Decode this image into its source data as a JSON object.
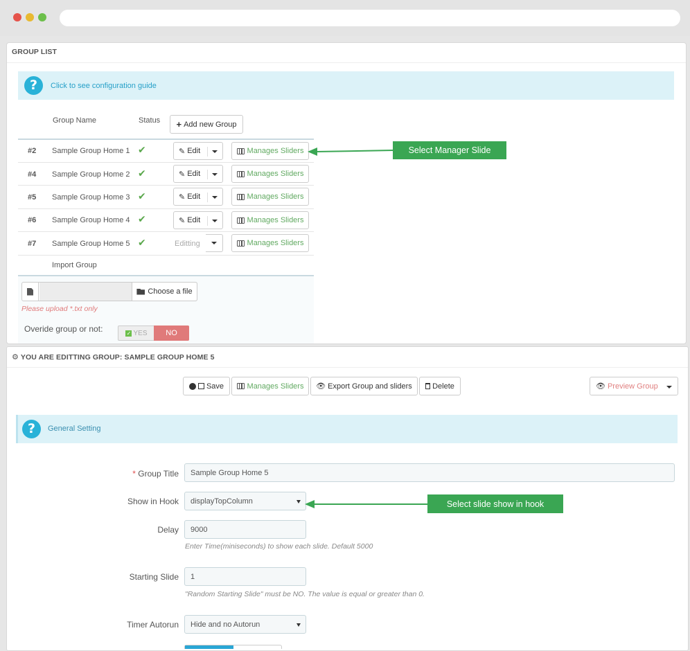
{
  "group_list": {
    "title": "GROUP LIST",
    "guide_link": "Click to see configuration guide",
    "headers": {
      "name": "Group Name",
      "status": "Status"
    },
    "add_button": "Add new Group",
    "rows": [
      {
        "id": "#2",
        "name": "Sample Group Home 1",
        "edit": "Edit",
        "manage": "Manages Sliders"
      },
      {
        "id": "#4",
        "name": "Sample Group Home 2",
        "edit": "Edit",
        "manage": "Manages Sliders"
      },
      {
        "id": "#5",
        "name": "Sample Group Home 3",
        "edit": "Edit",
        "manage": "Manages Sliders"
      },
      {
        "id": "#6",
        "name": "Sample Group Home 4",
        "edit": "Edit",
        "manage": "Manages Sliders"
      },
      {
        "id": "#7",
        "name": "Sample Group Home 5",
        "edit": "Editting",
        "manage": "Manages Sliders"
      }
    ],
    "import_label": "Import Group",
    "choose_file": "Choose a file",
    "upload_hint": "Please upload *.txt only",
    "override_label": "Overide group or not:",
    "yes": "YES",
    "no": "NO"
  },
  "annotations": {
    "manager_slide": "Select Manager Slide",
    "hook_slide": "Select slide show in hook"
  },
  "edit_panel": {
    "title": "YOU ARE EDITTING GROUP: SAMPLE GROUP HOME 5",
    "toolbar": {
      "save": "Save",
      "manage": "Manages Sliders",
      "export": "Export Group and sliders",
      "delete": "Delete",
      "preview": "Preview Group"
    },
    "section_title": "General Setting",
    "fields": {
      "group_title": {
        "label": "Group Title",
        "value": "Sample Group Home 5"
      },
      "hook": {
        "label": "Show in Hook",
        "value": "displayTopColumn"
      },
      "delay": {
        "label": "Delay",
        "value": "9000",
        "help": "Enter Time(miniseconds) to show each slide. Default 5000"
      },
      "starting_slide": {
        "label": "Starting Slide",
        "value": "1",
        "help": "\"Random Starting Slide\" must be NO. The value is equal or greater than 0."
      },
      "timer_autorun": {
        "label": "Timer Autorun",
        "value": "Hide and no Autorun"
      }
    }
  },
  "colors": {
    "accent_green": "#3aa653",
    "info_bg": "#dcf2f8",
    "no_red": "#e07a7a",
    "preview_red": "#e08080"
  }
}
